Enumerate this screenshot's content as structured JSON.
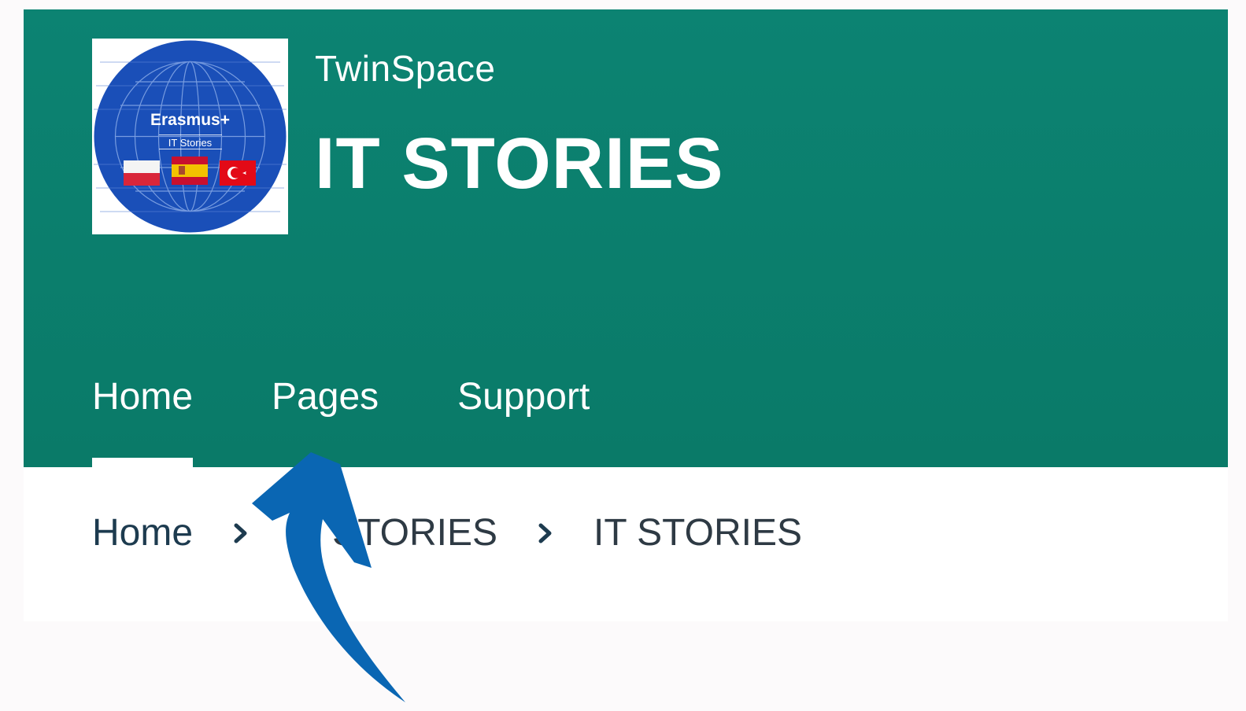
{
  "header": {
    "brand": "TwinSpace",
    "site_title": "IT STORIES",
    "logo": {
      "icon": "erasmus-globe-logo",
      "text_main": "Erasmus+",
      "text_sub": "IT Stories",
      "flags": [
        "poland-flag",
        "spain-flag",
        "turkey-flag"
      ],
      "background_color": "#1a4fb8"
    },
    "background_color": "#0c8372"
  },
  "nav": {
    "items": [
      {
        "label": "Home",
        "active": true
      },
      {
        "label": "Pages",
        "active": false
      },
      {
        "label": "Support",
        "active": false
      }
    ]
  },
  "breadcrumb": {
    "items": [
      "Home",
      "IT STORIES",
      "IT STORIES"
    ],
    "separator_icon": "chevron-right-icon"
  },
  "annotation": {
    "icon": "curved-arrow-up-icon",
    "color": "#0a66b3"
  }
}
